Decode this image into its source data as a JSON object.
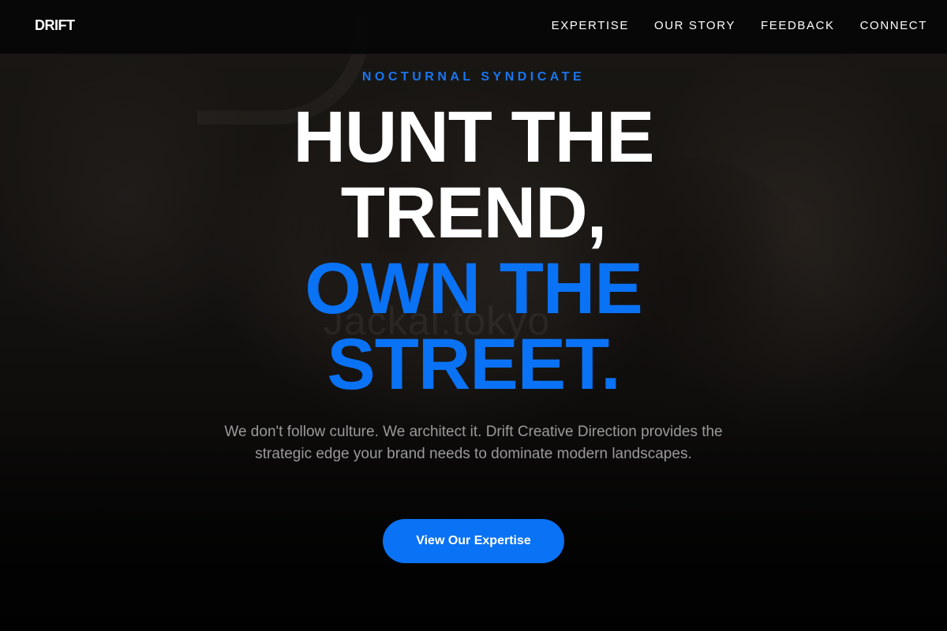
{
  "header": {
    "logo": "DRIFT",
    "nav": [
      {
        "label": "EXPERTISE"
      },
      {
        "label": "OUR STORY"
      },
      {
        "label": "FEEDBACK"
      },
      {
        "label": "CONNECT"
      }
    ]
  },
  "hero": {
    "eyebrow": "NOCTURNAL SYNDICATE",
    "headline_lines": [
      {
        "text": "HUNT THE",
        "color": "#ffffff"
      },
      {
        "text": "TREND,",
        "color": "#ffffff"
      },
      {
        "text": "OWN THE",
        "color": "#0a72f4"
      },
      {
        "text": "STREET.",
        "color": "#0a72f4"
      }
    ],
    "background_sign": "Jackal.tokyo",
    "description": "We don't follow culture. We architect it. Drift Creative Direction provides the strategic edge your brand needs to dominate modern landscapes.",
    "cta_label": "View Our Expertise"
  },
  "colors": {
    "accent": "#0a72f4",
    "background": "#0a0a0a",
    "text_primary": "#ffffff",
    "text_muted": "#9a9a9a"
  }
}
